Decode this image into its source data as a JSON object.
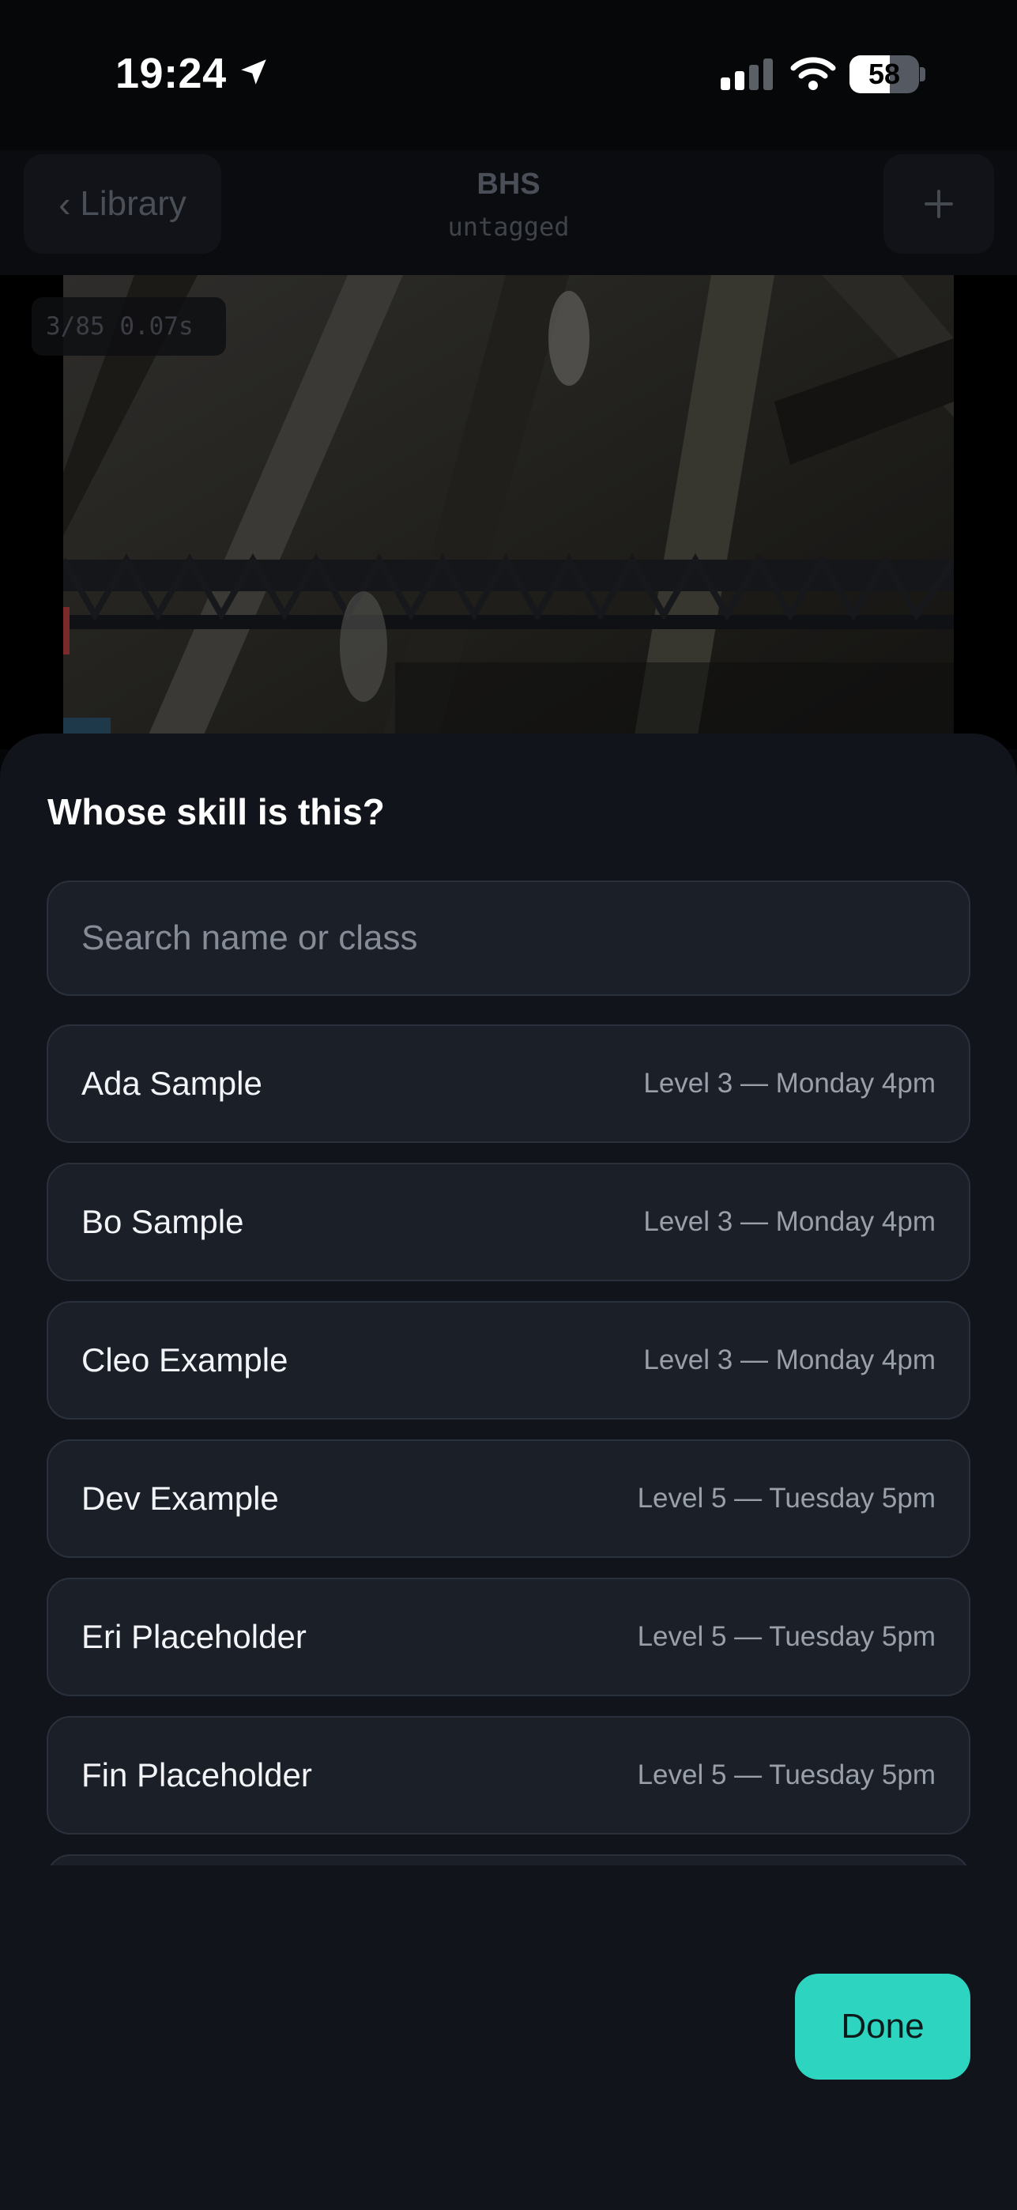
{
  "status_bar": {
    "time": "19:24",
    "battery_percent": 58,
    "icons": [
      "location-arrow-icon",
      "cellular-signal-icon",
      "wifi-icon",
      "battery-icon"
    ]
  },
  "header": {
    "back_label": "Library",
    "title": "BHS",
    "subtitle": "untagged",
    "add_icon": "plus-icon"
  },
  "player": {
    "frame_counter": "3/85 0.07s"
  },
  "sheet": {
    "title": "Whose skill is this?",
    "search": {
      "placeholder": "Search name or class",
      "value": ""
    },
    "students": [
      {
        "name": "Ada Sample",
        "class": "Level 3 — Monday 4pm"
      },
      {
        "name": "Bo Sample",
        "class": "Level 3 — Monday 4pm"
      },
      {
        "name": "Cleo Example",
        "class": "Level 3 — Monday 4pm"
      },
      {
        "name": "Dev Example",
        "class": "Level 5 — Tuesday 5pm"
      },
      {
        "name": "Eri Placeholder",
        "class": "Level 5 — Tuesday 5pm"
      },
      {
        "name": "Fin Placeholder",
        "class": "Level 5 — Tuesday 5pm"
      }
    ],
    "done_label": "Done"
  },
  "colors": {
    "accent": "#2dd4bf",
    "sheet_background": "#11141a",
    "row_background": "#1a1f28"
  }
}
